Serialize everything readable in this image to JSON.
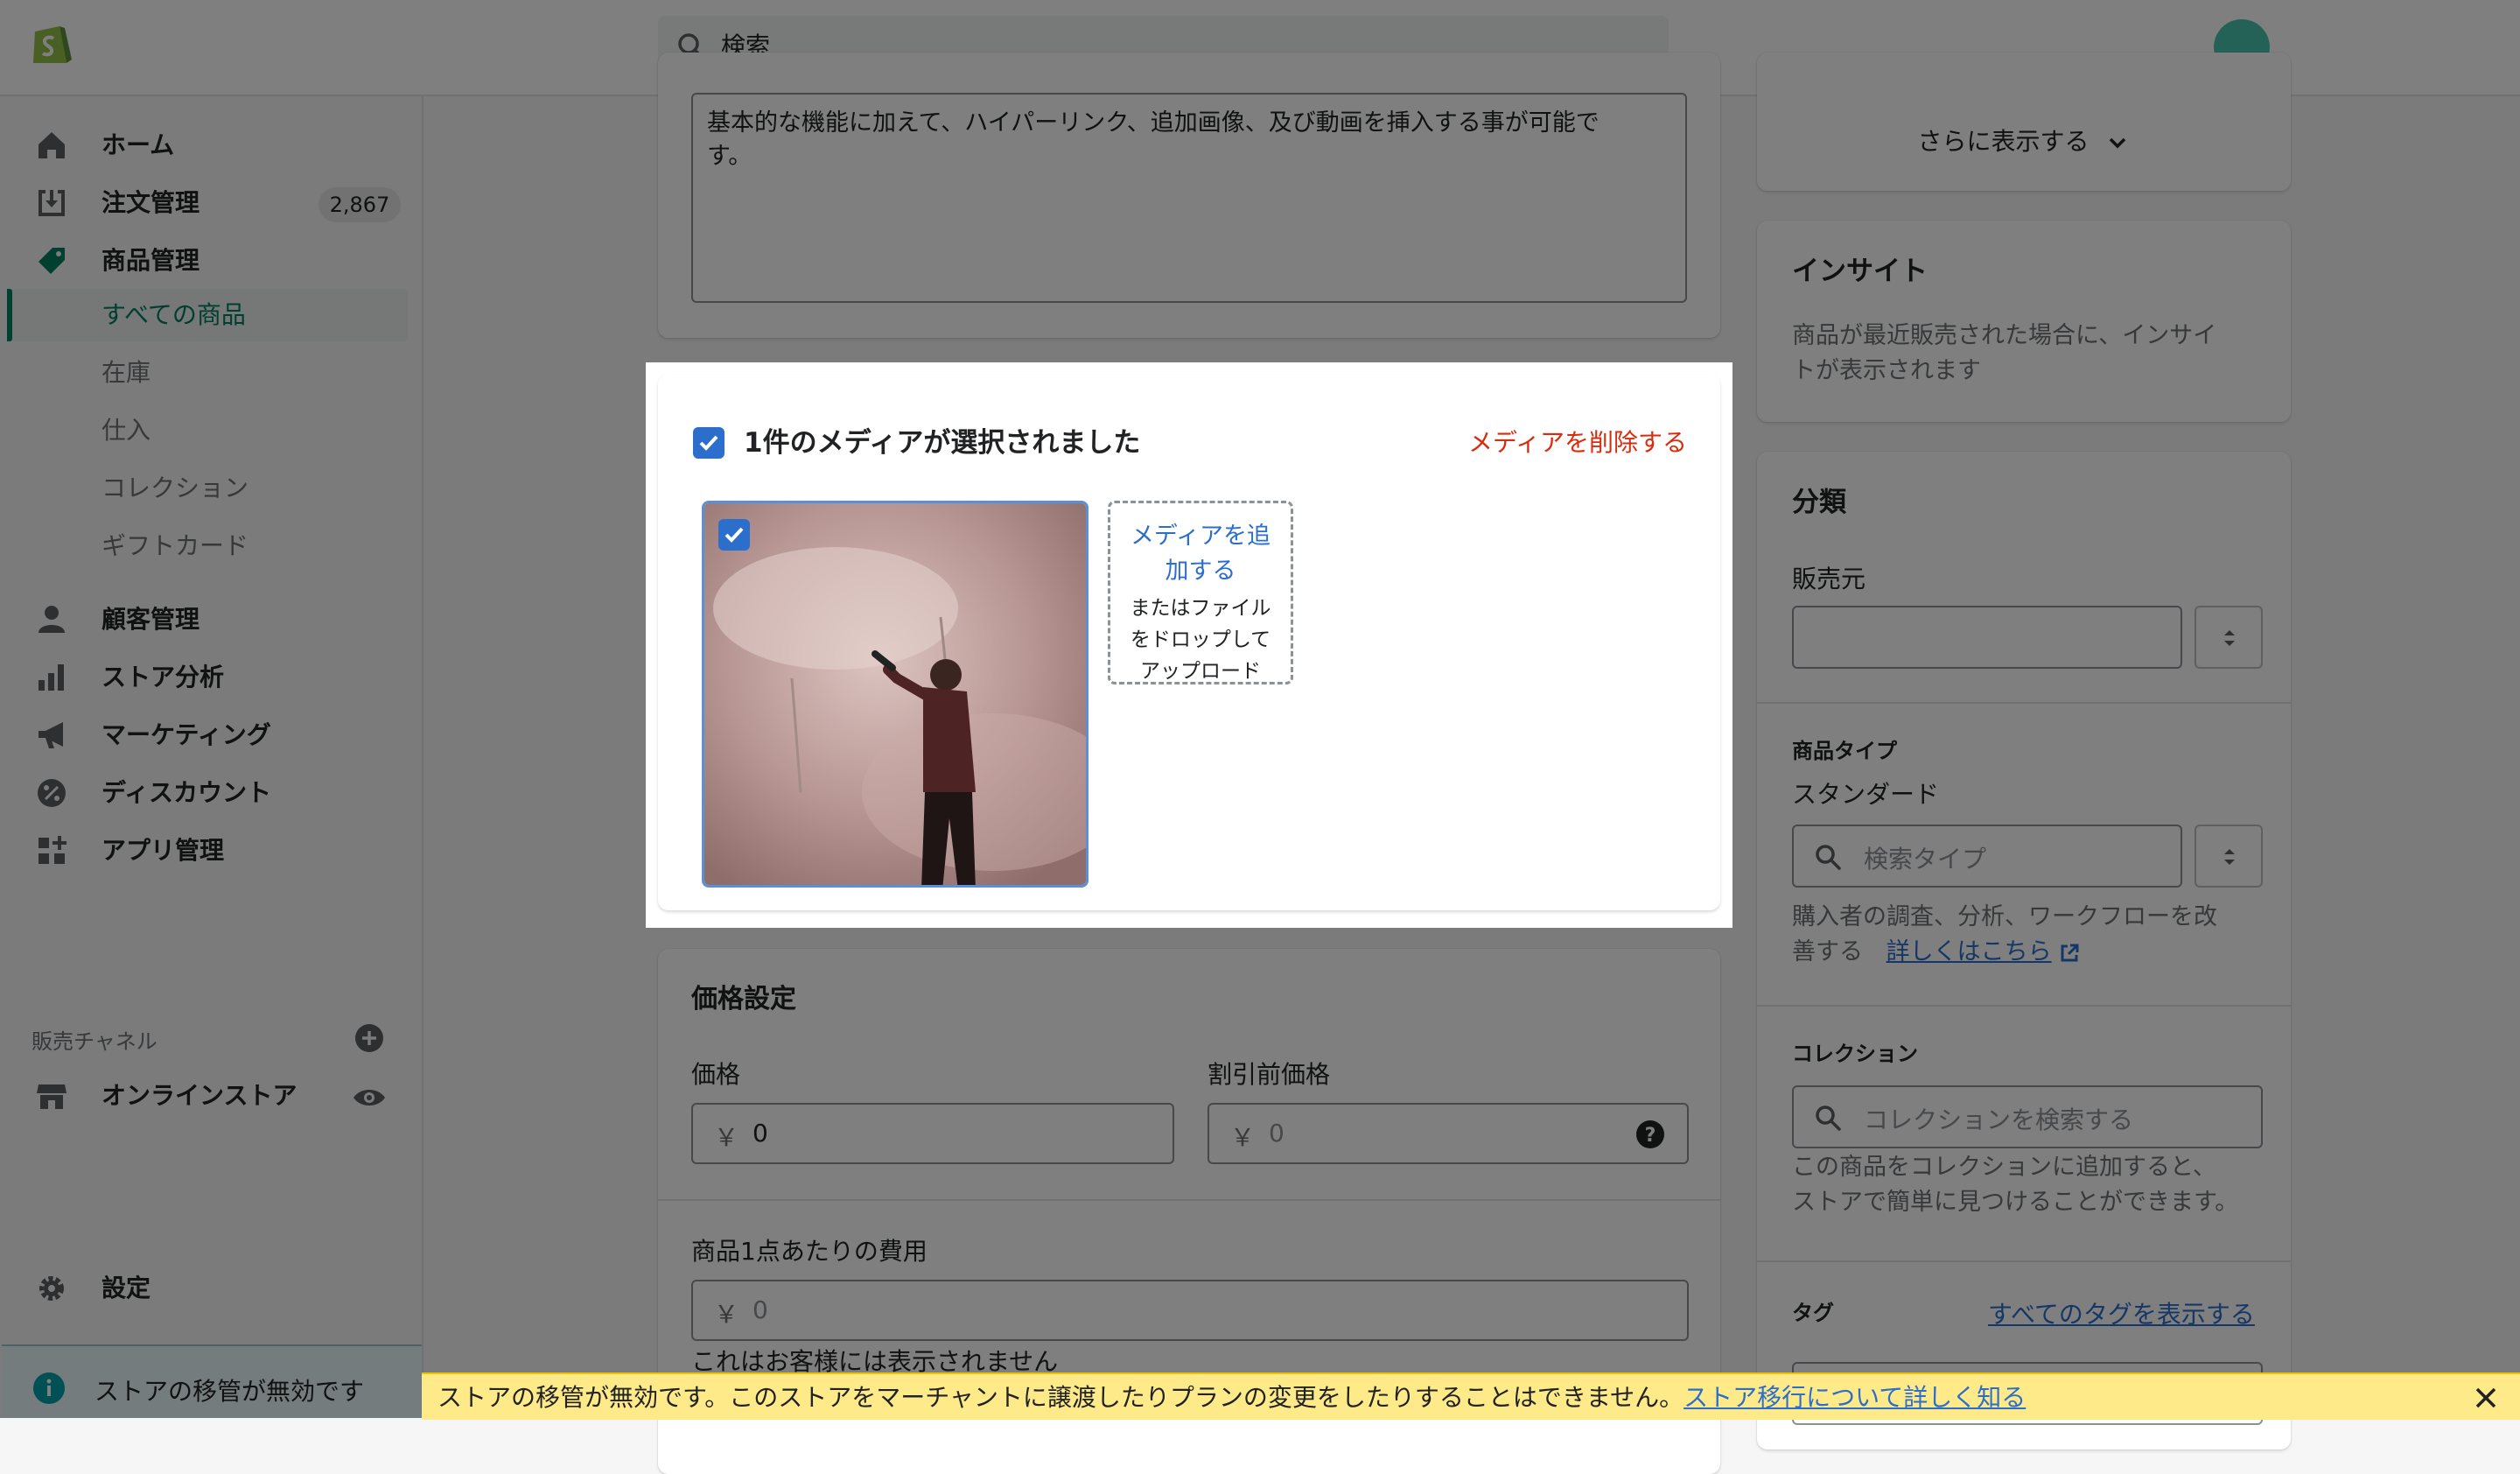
{
  "topbar": {
    "search_placeholder": "検索"
  },
  "sidebar": {
    "items": [
      {
        "label": "ホーム"
      },
      {
        "label": "注文管理",
        "badge": "2,867"
      },
      {
        "label": "商品管理"
      }
    ],
    "sub_items": [
      {
        "label": "すべての商品"
      },
      {
        "label": "在庫"
      },
      {
        "label": "仕入"
      },
      {
        "label": "コレクション"
      },
      {
        "label": "ギフトカード"
      }
    ],
    "items2": [
      {
        "label": "顧客管理"
      },
      {
        "label": "ストア分析"
      },
      {
        "label": "マーケティング"
      },
      {
        "label": "ディスカウント"
      },
      {
        "label": "アプリ管理"
      }
    ],
    "channels_label": "販売チャネル",
    "online_store": "オンラインストア",
    "settings": "設定",
    "store_banner": "ストアの移管が無効です"
  },
  "description": {
    "text_line1": "基本的な機能に加えて、ハイパーリンク、追加画像、及び動画を挿入する事が可能で",
    "text_line2": "す。"
  },
  "media": {
    "selected_label": "1件のメディアが選択されました",
    "delete_label": "メディアを削除する",
    "add_line1": "メディアを追",
    "add_line2": "加する",
    "drop_line1": "またはファイル",
    "drop_line2": "をドロップして",
    "drop_line3": "アップロード"
  },
  "pricing": {
    "title": "価格設定",
    "price_label": "価格",
    "currency": "￥",
    "price_value": "0",
    "compare_label": "割引前価格",
    "compare_value": "0",
    "cost_label": "商品1点あたりの費用",
    "cost_value": "0",
    "cost_help": "これはお客様には表示されません"
  },
  "right": {
    "show_more": "さらに表示する",
    "insights_title": "インサイト",
    "insights_line1": "商品が最近販売された場合に、インサイ",
    "insights_line2": "トが表示されます",
    "org_title": "分類",
    "vendor_label": "販売元",
    "type_title": "商品タイプ",
    "type_value": "スタンダード",
    "type_placeholder": "検索タイプ",
    "type_help_line1": "購入者の調査、分析、ワークフローを改",
    "type_help_line2": "善する",
    "type_help_link": "詳しくはこちら",
    "collections_title": "コレクション",
    "collections_placeholder": "コレクションを検索する",
    "collections_help_line1": "この商品をコレクションに追加すると、",
    "collections_help_line2": "ストアで簡単に見つけることができます。",
    "tags_title": "タグ",
    "tags_link": "すべてのタグを表示する"
  },
  "warning_bar": {
    "text": "ストアの移管が無効です。このストアをマーチャントに譲渡したりプランの変更をしたりすることはできません。",
    "link": "ストア移行について詳しく知る"
  },
  "colors": {
    "primary": "#008060",
    "link": "#2c6ecb",
    "critical": "#d72c0d",
    "warning_bg": "#ffea8a"
  }
}
